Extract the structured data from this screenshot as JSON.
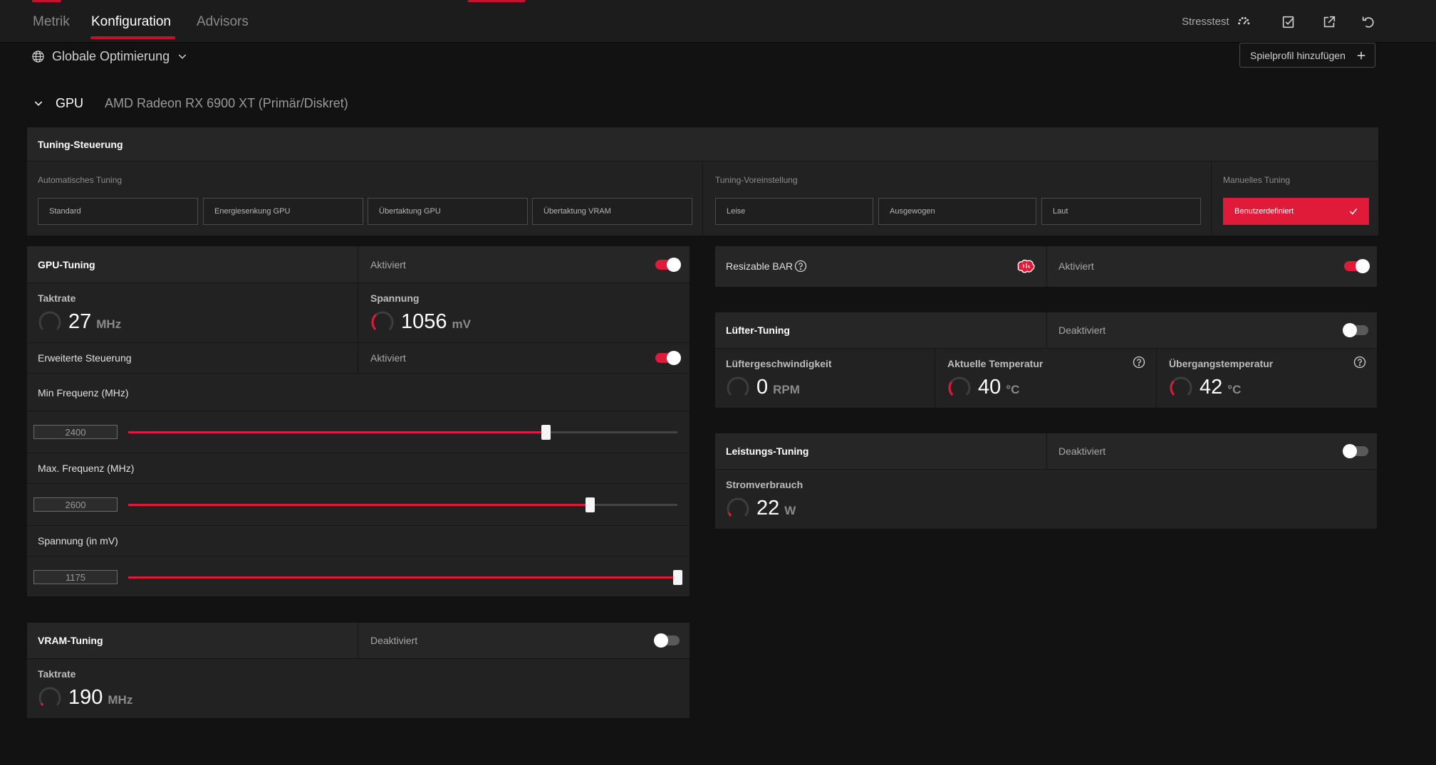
{
  "topbar": {
    "tabs": [
      {
        "label": "Metrik"
      },
      {
        "label": "Konfiguration"
      },
      {
        "label": "Advisors"
      }
    ],
    "stresstest_label": "Stresstest",
    "icons": [
      "speedometer-icon",
      "checklist-icon",
      "export-icon",
      "reset-icon"
    ]
  },
  "profile": {
    "selector_label": "Globale Optimierung",
    "add_button": "Spielprofil hinzufügen"
  },
  "gpu": {
    "label": "GPU",
    "name": "AMD Radeon RX 6900 XT (Primär/Diskret)"
  },
  "tuning_control": {
    "title": "Tuning-Steuerung",
    "auto": {
      "label": "Automatisches Tuning",
      "options": [
        "Standard",
        "Energiesenkung GPU",
        "Übertaktung GPU",
        "Übertaktung VRAM"
      ]
    },
    "preset": {
      "label": "Tuning-Voreinstellung",
      "options": [
        "Leise",
        "Ausgewogen",
        "Laut"
      ]
    },
    "manual": {
      "label": "Manuelles Tuning",
      "selected": "Benutzerdefiniert"
    }
  },
  "gpu_tuning": {
    "title": "GPU-Tuning",
    "state": "Aktiviert",
    "enabled": true,
    "clock": {
      "label": "Taktrate",
      "value": "27",
      "unit": "MHz",
      "gauge_fraction": 0.0
    },
    "voltage": {
      "label": "Spannung",
      "value": "1056",
      "unit": "mV",
      "gauge_fraction": 0.35
    },
    "advanced": {
      "label": "Erweiterte Steuerung",
      "state": "Aktiviert",
      "enabled": true
    },
    "min_freq": {
      "label": "Min Frequenz (MHz)",
      "value": "2400",
      "fraction": 0.76
    },
    "max_freq": {
      "label": "Max. Frequenz (MHz)",
      "value": "2600",
      "fraction": 0.84
    },
    "voltage_slider": {
      "label": "Spannung (in mV)",
      "value": "1175",
      "fraction": 1.0
    }
  },
  "vram_tuning": {
    "title": "VRAM-Tuning",
    "state": "Deaktiviert",
    "enabled": false,
    "clock": {
      "label": "Taktrate",
      "value": "190",
      "unit": "MHz",
      "gauge_fraction": 0.05
    }
  },
  "resizable_bar": {
    "title": "Resizable BAR",
    "state": "Aktiviert",
    "enabled": true
  },
  "fan_tuning": {
    "title": "Lüfter-Tuning",
    "state": "Deaktiviert",
    "enabled": false,
    "fan_speed": {
      "label": "Lüftergeschwindigkeit",
      "value": "0",
      "unit": "RPM",
      "gauge_fraction": 0.0
    },
    "temp": {
      "label": "Aktuelle Temperatur",
      "value": "40",
      "unit": "°C",
      "gauge_fraction": 0.3
    },
    "junction": {
      "label": "Übergangstemperatur",
      "value": "42",
      "unit": "°C",
      "gauge_fraction": 0.32
    }
  },
  "power_tuning": {
    "title": "Leistungs-Tuning",
    "state": "Deaktiviert",
    "enabled": false,
    "power": {
      "label": "Stromverbrauch",
      "value": "22",
      "unit": "W",
      "gauge_fraction": 0.08
    }
  },
  "colors": {
    "accent": "#e01b3a",
    "background": "#121212",
    "panel": "#222222"
  }
}
